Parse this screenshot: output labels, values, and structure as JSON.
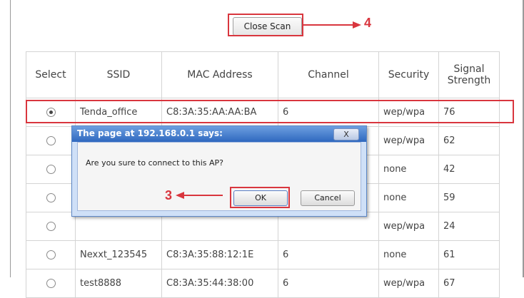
{
  "scan": {
    "close_label": "Close Scan",
    "step_label": "4"
  },
  "table": {
    "headers": [
      "Select",
      "SSID",
      "MAC Address",
      "Channel",
      "Security",
      "Signal Strength"
    ],
    "rows": [
      {
        "selected": true,
        "ssid": "Tenda_office",
        "mac": "C8:3A:35:AA:AA:BA",
        "channel": "6",
        "security": "wep/wpa",
        "signal": "76"
      },
      {
        "selected": false,
        "ssid": "",
        "mac": "",
        "channel": "",
        "security": "wep/wpa",
        "signal": "62"
      },
      {
        "selected": false,
        "ssid": "",
        "mac": "",
        "channel": "",
        "security": "none",
        "signal": "42"
      },
      {
        "selected": false,
        "ssid": "",
        "mac": "",
        "channel": "",
        "security": "none",
        "signal": "59"
      },
      {
        "selected": false,
        "ssid": "",
        "mac": "",
        "channel": "",
        "security": "wep/wpa",
        "signal": "24"
      },
      {
        "selected": false,
        "ssid": "Nexxt_123545",
        "mac": "C8:3A:35:88:12:1E",
        "channel": "6",
        "security": "none",
        "signal": "61"
      },
      {
        "selected": false,
        "ssid": "test8888",
        "mac": "C8:3A:35:44:38:00",
        "channel": "6",
        "security": "wep/wpa",
        "signal": "67"
      }
    ]
  },
  "dialog": {
    "title": "The page at 192.168.0.1 says:",
    "close_label": "X",
    "message": "Are you sure to connect to this AP?",
    "ok_label": "OK",
    "cancel_label": "Cancel",
    "step_label": "3"
  },
  "colors": {
    "annotation": "#d9363e",
    "dialog_title": "#2f68bf"
  }
}
